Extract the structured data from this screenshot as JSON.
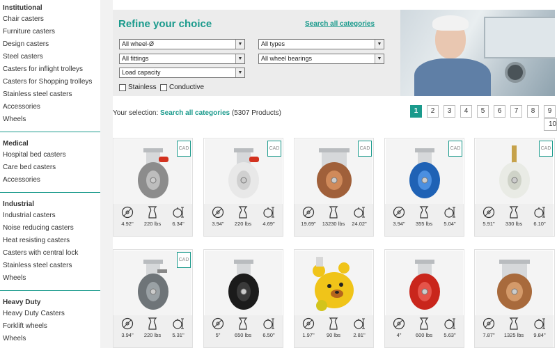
{
  "sidebar": {
    "groups": [
      {
        "title": "Institutional",
        "items": [
          "Chair casters",
          "Furniture casters",
          "Design casters",
          "Steel casters",
          "Casters for inflight trolleys",
          "Casters for Shopping trolleys",
          "Stainless steel casters",
          "Accessories",
          "Wheels"
        ]
      },
      {
        "title": "Medical",
        "items": [
          "Hospital bed casters",
          "Care bed casters",
          "Accessories"
        ]
      },
      {
        "title": "Industrial",
        "items": [
          "Industrial casters",
          "Noise reducing casters",
          "Heat resisting casters",
          "Casters with central lock",
          "Stainless steel casters",
          "Wheels"
        ]
      },
      {
        "title": "Heavy Duty",
        "items": [
          "Heavy Duty Casters",
          "Forklift wheels",
          "Wheels"
        ]
      }
    ]
  },
  "refine": {
    "title": "Refine your choice",
    "search_all": "Search all categories",
    "selects": {
      "wheel": "All wheel-Ø",
      "types": "All types",
      "fittings": "All fittings",
      "bearings": "All wheel bearings",
      "load": "Load capacity"
    },
    "checks": {
      "stainless": "Stainless",
      "conductive": "Conductive"
    }
  },
  "selection": {
    "prefix": "Your selection:",
    "link": "Search all categories",
    "count": "(5307 Products)"
  },
  "pagination": [
    "1",
    "2",
    "3",
    "4",
    "5",
    "6",
    "7",
    "8",
    "9",
    "10"
  ],
  "cad_label": "CAD",
  "products": [
    {
      "d": "4.92\"",
      "load": "220 lbs",
      "h": "6.34\"",
      "cad": true,
      "style": "grey-red"
    },
    {
      "d": "3.94\"",
      "load": "220 lbs",
      "h": "4.69\"",
      "cad": true,
      "style": "white-red"
    },
    {
      "d": "19.69\"",
      "load": "13230 lbs",
      "h": "24.02\"",
      "cad": true,
      "style": "brown-heavy"
    },
    {
      "d": "3.94\"",
      "load": "355 lbs",
      "h": "5.04\"",
      "cad": true,
      "style": "blue"
    },
    {
      "d": "5.91\"",
      "load": "330 lbs",
      "h": "6.10\"",
      "cad": true,
      "style": "white-stem"
    },
    {
      "d": "3.94\"",
      "load": "220 lbs",
      "h": "5.31\"",
      "cad": true,
      "style": "grey-brake"
    },
    {
      "d": "5\"",
      "load": "650 lbs",
      "h": "6.50\"",
      "cad": false,
      "style": "black"
    },
    {
      "d": "1.97\"",
      "load": "90 lbs",
      "h": "2.81\"",
      "cad": false,
      "style": "bear"
    },
    {
      "d": "4\"",
      "load": "600 lbs",
      "h": "5.63\"",
      "cad": false,
      "style": "red"
    },
    {
      "d": "7.87\"",
      "load": "1325 lbs",
      "h": "9.84\"",
      "cad": false,
      "style": "brown-plate"
    }
  ]
}
